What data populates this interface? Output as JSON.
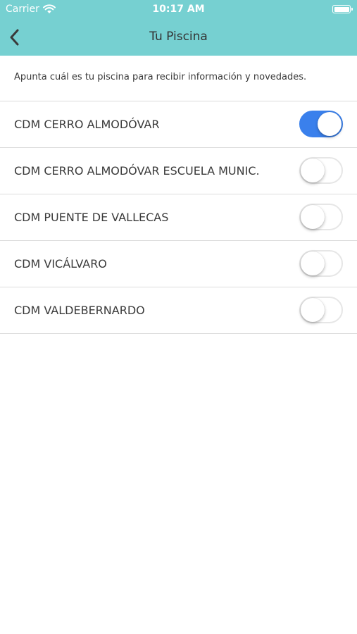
{
  "status_bar": {
    "carrier": "Carrier",
    "time": "10:17 AM",
    "signal_icon": "wifi-icon",
    "battery_icon": "battery-icon"
  },
  "nav": {
    "title": "Tu Piscina",
    "back_icon": "chevron-left-icon"
  },
  "intro_text": "Apunta cuál es tu piscina para recibir información y novedades.",
  "pools": [
    {
      "label": "CDM CERRO ALMODÓVAR",
      "enabled": true
    },
    {
      "label": "CDM CERRO ALMODÓVAR ESCUELA MUNIC.",
      "enabled": false
    },
    {
      "label": "CDM PUENTE DE VALLECAS",
      "enabled": false
    },
    {
      "label": "CDM VICÁLVARO",
      "enabled": false
    },
    {
      "label": "CDM VALDEBERNARDO",
      "enabled": false
    }
  ],
  "colors": {
    "header": "#76d0d1",
    "toggle_on": "#3a80ec",
    "separator": "#dcdcdc"
  }
}
